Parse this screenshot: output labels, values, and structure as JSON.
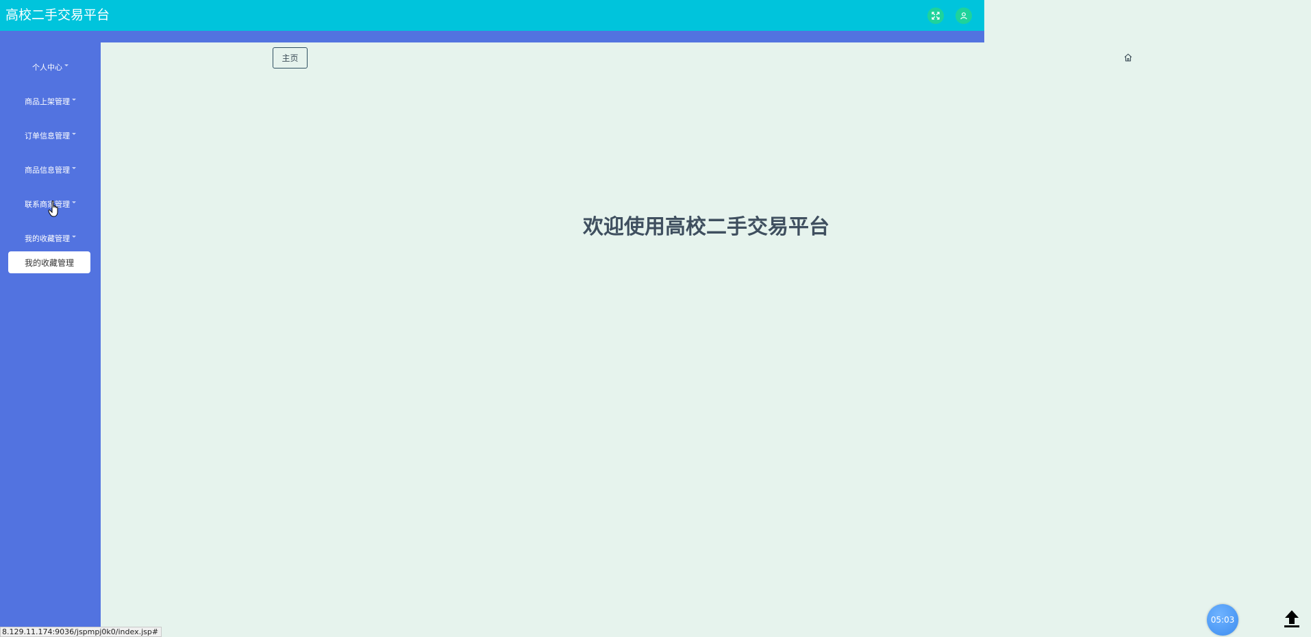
{
  "header": {
    "title": "高校二手交易平台",
    "colors": {
      "bar": "#00c4dc",
      "icon_bg": "#1ed39b"
    },
    "icons": [
      "fullscreen-icon",
      "user-icon"
    ]
  },
  "sidebar": {
    "items": [
      {
        "label": "个人中心"
      },
      {
        "label": "商品上架管理"
      },
      {
        "label": "订单信息管理"
      },
      {
        "label": "商品信息管理"
      },
      {
        "label": "联系商家管理"
      },
      {
        "label": "我的收藏管理"
      }
    ],
    "submenu": {
      "label": "我的收藏管理"
    },
    "color": "#5273e0"
  },
  "main": {
    "home_tab": "主页",
    "welcome": "欢迎使用高校二手交易平台"
  },
  "statusbar": {
    "url": "8.129.11.174:9036/jspmpj0k0/index.jsp#"
  },
  "timer": {
    "value": "05:03"
  }
}
